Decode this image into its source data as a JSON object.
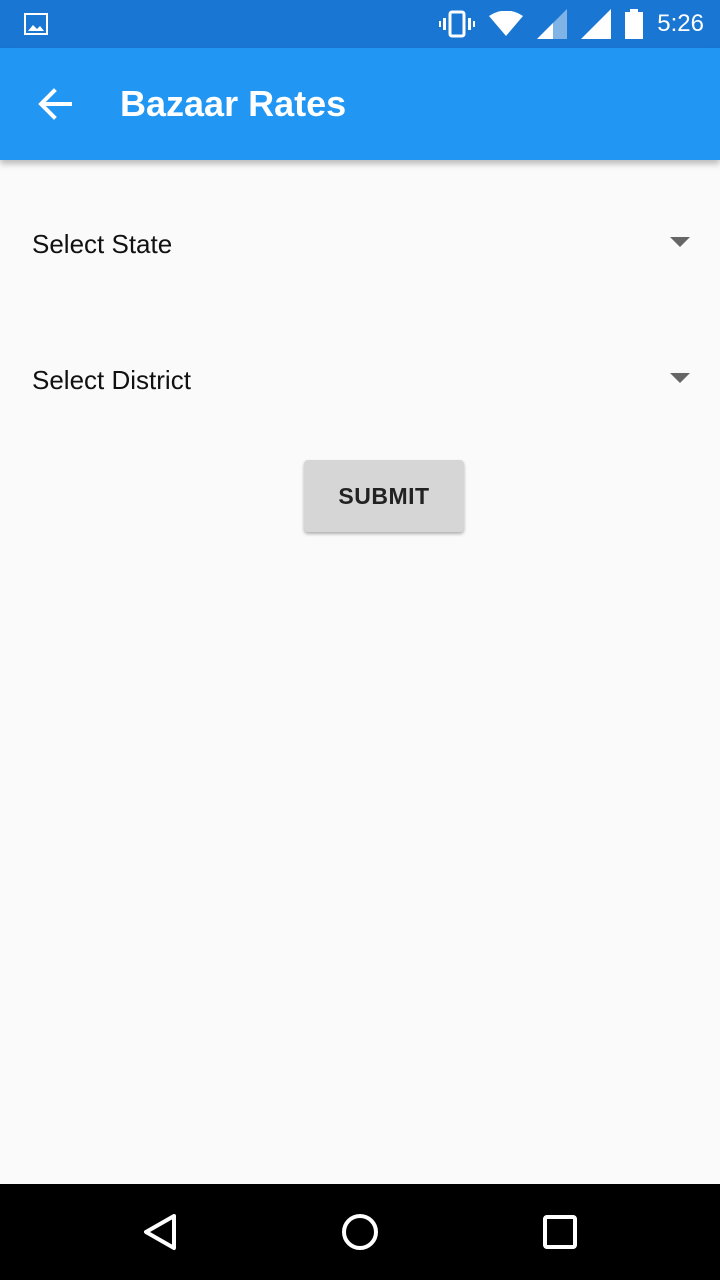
{
  "status_bar": {
    "time": "5:26",
    "icons": [
      "image-icon",
      "vibrate-icon",
      "wifi-icon",
      "signal-icon",
      "signal-full-icon",
      "battery-icon"
    ],
    "background": "#1976d2"
  },
  "app_bar": {
    "title": "Bazaar Rates",
    "back_icon": "arrow-back-icon",
    "background": "#2196f3"
  },
  "form": {
    "state_select": {
      "value": "Select State"
    },
    "district_select": {
      "value": "Select District"
    },
    "submit_label": "SUBMIT"
  },
  "nav_bar": {
    "icons": [
      "back-triangle-icon",
      "home-circle-icon",
      "recents-square-icon"
    ]
  }
}
